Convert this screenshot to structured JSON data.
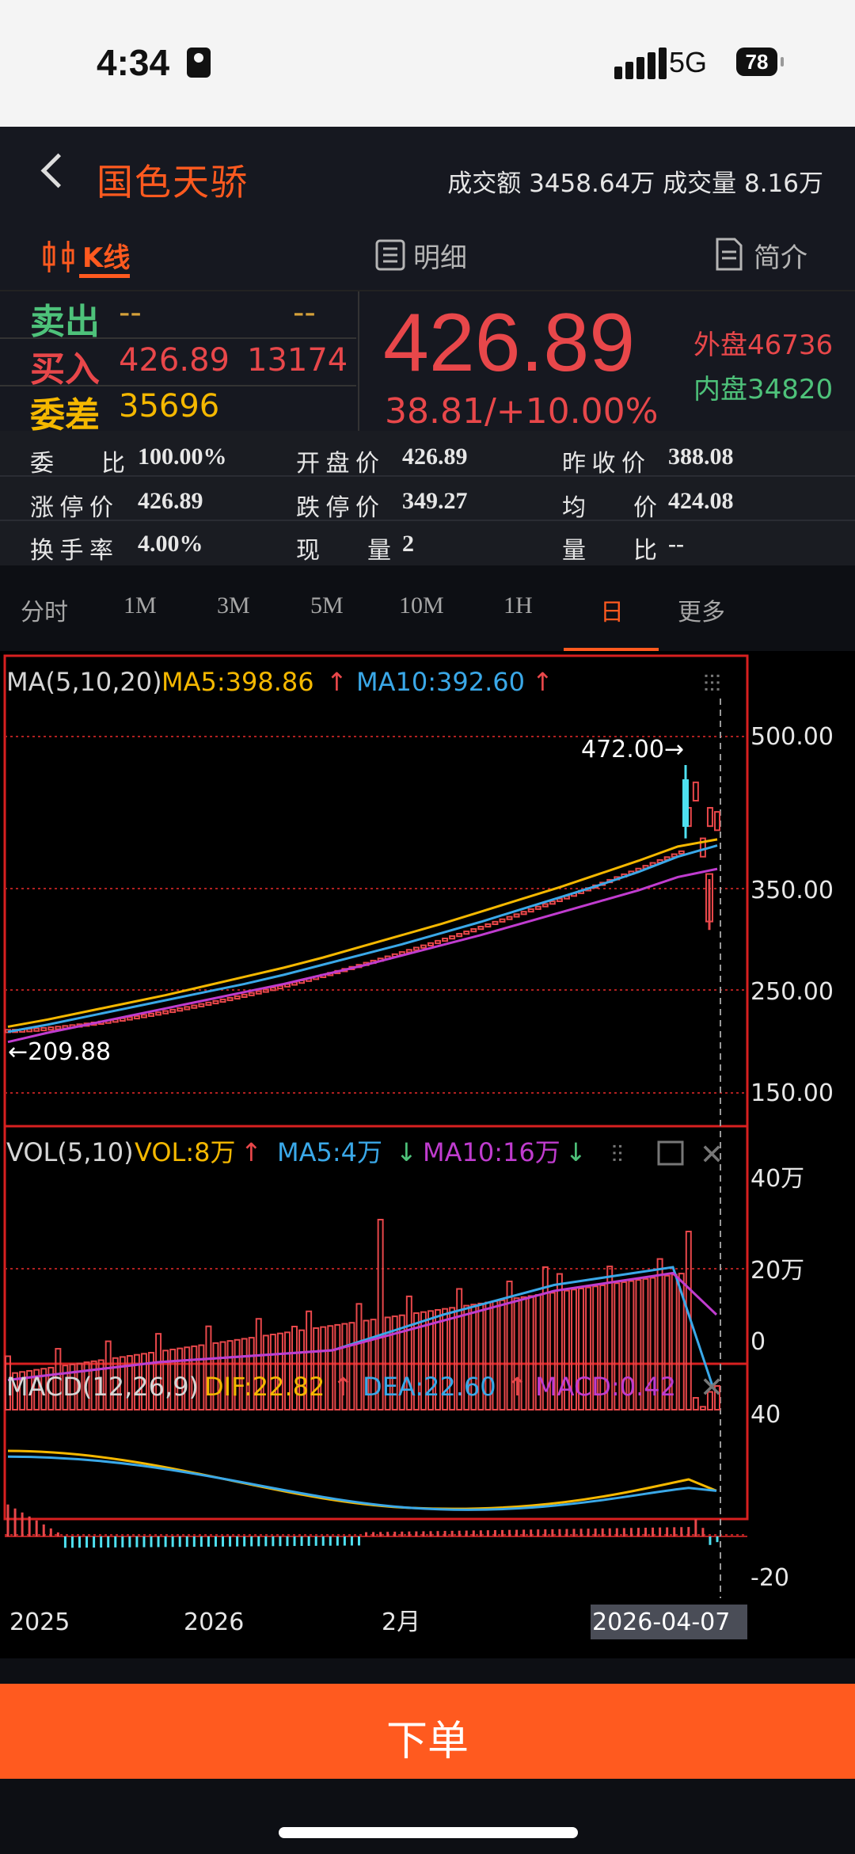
{
  "status": {
    "time": "4:34",
    "network": "5G",
    "battery": "78"
  },
  "header": {
    "back": "back",
    "name": "国色天骄",
    "turnover": "成交额 3458.64万   成交量 8.16万"
  },
  "tabs": [
    {
      "label": "K线",
      "active": true
    },
    {
      "label": "明细"
    },
    {
      "label": "简介"
    }
  ],
  "quote": {
    "sell_label": "卖出",
    "sell_price": "--",
    "sell_vol": "--",
    "buy_label": "买入",
    "buy_price": "426.89",
    "buy_vol": "13174",
    "diff_label": "委差",
    "diff_value": "35696",
    "price": "426.89",
    "change": "38.81/+10.00%",
    "outer": "外盘46736",
    "inner": "内盘34820",
    "colors": {
      "up": "#e8474a",
      "down": "#4ec27a",
      "accent": "#ff5a1f"
    }
  },
  "stats": [
    {
      "label": "委　　比",
      "value": "100.00%"
    },
    {
      "label": "开 盘 价",
      "value": "426.89"
    },
    {
      "label": "昨 收 价",
      "value": "388.08"
    },
    {
      "label": "涨 停 价",
      "value": "426.89"
    },
    {
      "label": "跌 停 价",
      "value": "349.27"
    },
    {
      "label": "均　　价",
      "value": "424.08"
    },
    {
      "label": "换 手 率",
      "value": "4.00%"
    },
    {
      "label": "现　　量",
      "value": "2"
    },
    {
      "label": "量　　比",
      "value": "--"
    }
  ],
  "periods": [
    "分时",
    "1M",
    "3M",
    "5M",
    "10M",
    "1H",
    "日",
    "更多"
  ],
  "active_period": "日",
  "chart_data": [
    {
      "type": "candlestick",
      "title": "MA(5,10,20)",
      "legend": [
        "MA5:398.86",
        "MA10:392.60"
      ],
      "ylim": [
        150,
        500
      ],
      "y_ticks": [
        "500.00",
        "350.00",
        "250.00",
        "150.00"
      ],
      "annotations": [
        "472.00→",
        "←209.88"
      ],
      "series": [
        {
          "name": "MA5",
          "color": "#f5b800",
          "values": [
            215,
            222,
            230,
            238,
            246,
            255,
            264,
            273,
            283,
            294,
            305,
            316,
            328,
            340,
            352,
            365,
            378,
            392,
            399
          ]
        },
        {
          "name": "MA10",
          "color": "#3aa8e8",
          "values": [
            210,
            217,
            225,
            233,
            241,
            249,
            257,
            266,
            276,
            286,
            296,
            307,
            318,
            330,
            342,
            354,
            367,
            382,
            393
          ]
        },
        {
          "name": "MA20",
          "color": "#c03ccf",
          "values": [
            200,
            209,
            217,
            225,
            233,
            241,
            249,
            257,
            266,
            275,
            285,
            295,
            305,
            316,
            327,
            338,
            349,
            362,
            370
          ]
        }
      ]
    },
    {
      "type": "bar",
      "title": "VOL(5,10)",
      "legend": [
        "VOL:8万",
        "MA5:4万",
        "MA10:16万"
      ],
      "y_ticks": [
        "40万",
        "20万",
        "0"
      ],
      "ylim": [
        0,
        40
      ]
    },
    {
      "type": "bar",
      "title": "MACD(12,26,9)",
      "legend": [
        "DIF:22.82",
        "DEA:22.60",
        "MACD:0.42"
      ],
      "y_ticks": [
        "40",
        "-20"
      ],
      "ylim": [
        -20,
        40
      ]
    }
  ],
  "x_axis": [
    "2025",
    "2026",
    "2月",
    "2026-04-07"
  ],
  "order_button": "下单"
}
